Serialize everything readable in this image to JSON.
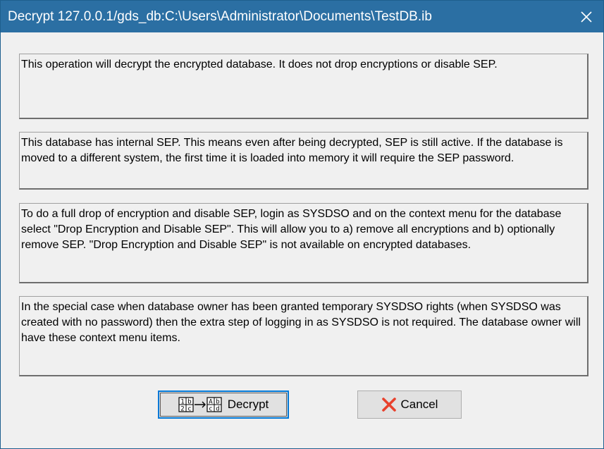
{
  "window": {
    "title": "Decrypt 127.0.0.1/gds_db:C:\\Users\\Administrator\\Documents\\TestDB.ib",
    "close_icon": "close-icon"
  },
  "messages": [
    "This operation will decrypt the encrypted database.  It does not drop encryptions or disable SEP.",
    "This database has internal SEP.  This means even after being decrypted, SEP is still active.  If the database is moved to a different system, the first time it is loaded into memory it will require the SEP password.",
    "To do a full drop of encryption and disable SEP, login as SYSDSO and on the context menu for the database select \"Drop Encryption and Disable SEP\".  This will allow you to a) remove all encryptions and b) optionally remove SEP.  \"Drop Encryption and Disable SEP\" is not available on encrypted databases.",
    "In the special case when database owner has been granted temporary SYSDSO rights (when SYSDSO was created with no password) then the extra step of logging in as SYSDSO is not required.  The database owner will have these context menu items."
  ],
  "buttons": {
    "decrypt_label": "Decrypt",
    "decrypt_icon": "decrypt-icon",
    "cancel_label": "Cancel",
    "cancel_icon": "cancel-x-icon"
  },
  "colors": {
    "titlebar": "#2b6fa3",
    "accent": "#0078d7",
    "cancel_x": "#e8412c"
  }
}
